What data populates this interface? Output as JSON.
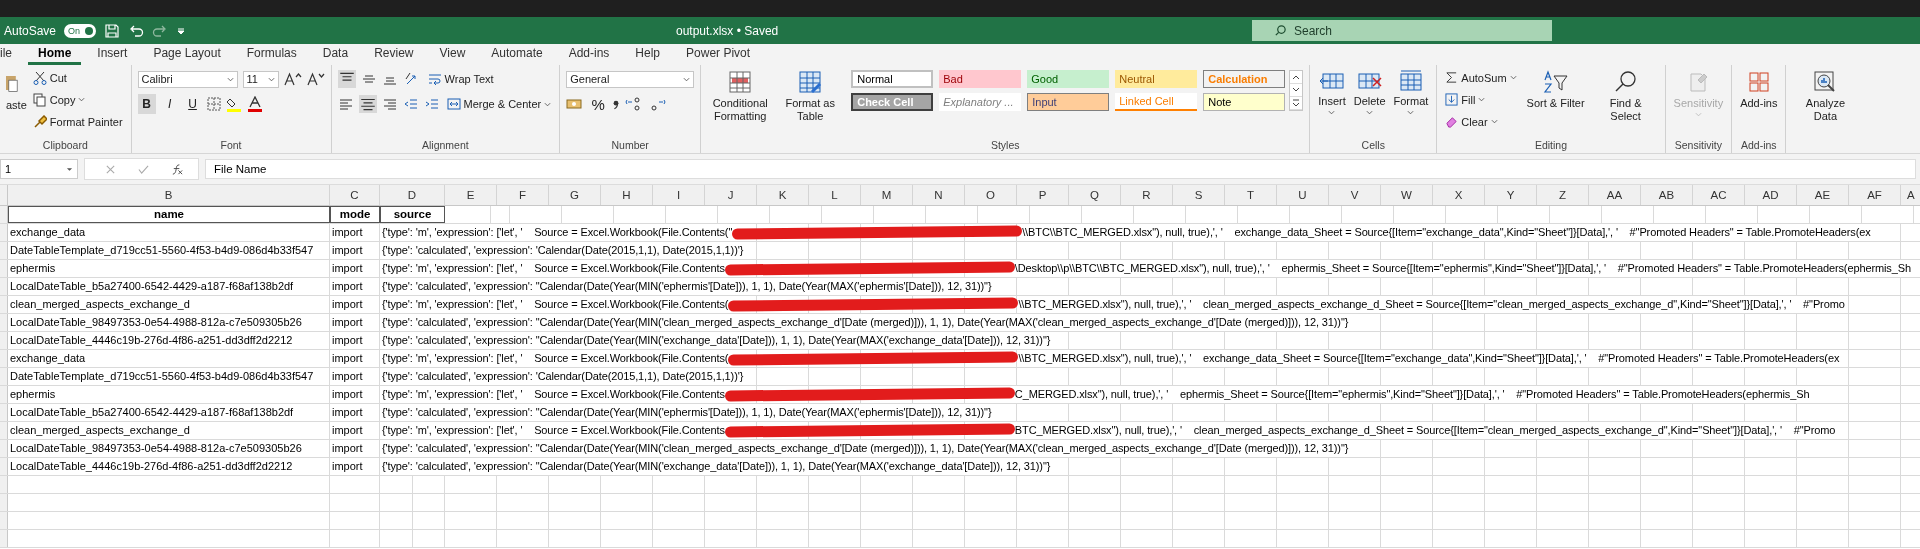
{
  "title_bar": {
    "autosave_label": "AutoSave",
    "autosave_toggle": {
      "label": "On",
      "on": true
    },
    "title": "output.xlsx • Saved",
    "search": {
      "placeholder": "Search"
    }
  },
  "tabs": [
    {
      "label": "ile",
      "selected": false
    },
    {
      "label": "Home",
      "selected": true
    },
    {
      "label": "Insert",
      "selected": false
    },
    {
      "label": "Page Layout",
      "selected": false
    },
    {
      "label": "Formulas",
      "selected": false
    },
    {
      "label": "Data",
      "selected": false
    },
    {
      "label": "Review",
      "selected": false
    },
    {
      "label": "View",
      "selected": false
    },
    {
      "label": "Automate",
      "selected": false
    },
    {
      "label": "Add-ins",
      "selected": false
    },
    {
      "label": "Help",
      "selected": false
    },
    {
      "label": "Power Pivot",
      "selected": false
    }
  ],
  "ribbon": {
    "clipboard": {
      "paste": "aste",
      "cut": "Cut",
      "copy": "Copy",
      "format_painter": "Format Painter",
      "label": "Clipboard"
    },
    "font": {
      "name": "Calibri",
      "size": "11",
      "bold": "B",
      "italic": "I",
      "underline": "U",
      "label": "Font"
    },
    "alignment": {
      "wrap_text": "Wrap Text",
      "merge": "Merge & Center",
      "label": "Alignment"
    },
    "number": {
      "format": "General",
      "percent": "%",
      "label": "Number"
    },
    "styles": {
      "conditional": "Conditional Formatting",
      "format_table": "Format as Table",
      "label": "Styles",
      "cells": [
        {
          "label": "Normal",
          "color": "#ffffff"
        },
        {
          "label": "Bad",
          "color": "#ffc7ce"
        },
        {
          "label": "Good",
          "color": "#c6efce"
        },
        {
          "label": "Neutral",
          "color": "#ffeb9c"
        },
        {
          "label": "Calculation",
          "color": "#f2f2f2"
        },
        {
          "label": "Check Cell",
          "color": "#a5a5a5"
        },
        {
          "label": "Explanatory ...",
          "color": "#ffffff"
        },
        {
          "label": "Input",
          "color": "#ffcc99"
        },
        {
          "label": "Linked Cell",
          "color": "#ffffff"
        },
        {
          "label": "Note",
          "color": "#ffffcc"
        }
      ]
    },
    "cells": {
      "insert": "Insert",
      "delete": "Delete",
      "format": "Format",
      "label": "Cells"
    },
    "editing": {
      "autosum": "AutoSum",
      "fill": "Fill",
      "clear": "Clear",
      "sort": "Sort & Filter",
      "find": "Find & Select",
      "label": "Editing"
    },
    "sensitivity": {
      "button": "Sensitivity",
      "disabled": true,
      "label": "Sensitivity"
    },
    "addins": {
      "addins": "Add-ins",
      "analyze": "Analyze Data",
      "label": "Add-ins"
    }
  },
  "formula_bar": {
    "name_box": "1",
    "formula": "File Name"
  },
  "columns": [
    "B",
    "C",
    "D",
    "E",
    "F",
    "G",
    "H",
    "I",
    "J",
    "K",
    "L",
    "M",
    "N",
    "O",
    "P",
    "Q",
    "R",
    "S",
    "T",
    "U",
    "V",
    "W",
    "X",
    "Y",
    "Z",
    "AA",
    "AB",
    "AC",
    "AD",
    "AE",
    "AF",
    "A"
  ],
  "table": {
    "columns": [
      "name",
      "mode",
      "source"
    ],
    "rows": [
      {
        "name": "exchange_data",
        "mode": "import",
        "source": {
          "text": "{'type': 'm', 'expression': ['let', '    Source = Excel.Workbook(File.Contents(\"",
          "redacted": true,
          "after": "\\\\BTC\\\\BTC_MERGED.xlsx\"), null, true),', '    exchange_data_Sheet = Source{[Item=\"exchange_data\",Kind=\"Sheet\"]}[Data],', '    #\"Promoted Headers\" = Table.PromoteHeaders(ex"
        }
      },
      {
        "name": "DateTableTemplate_d719cc51-5560-4f53-b4d9-086d4b33f547",
        "mode": "import",
        "source": {
          "text": "{'type': 'calculated', 'expression': 'Calendar(Date(2015,1,1), Date(2015,1,1))'}",
          "redacted": false
        }
      },
      {
        "name": "ephermis",
        "mode": "import",
        "source": {
          "text": "{'type': 'm', 'expression': ['let', '    Source = Excel.Workbook(File.Contents",
          "redacted": true,
          "after": "\\Desktop\\\\p\\\\BTC\\\\BTC_MERGED.xlsx\"), null, true),', '    ephermis_Sheet = Source{[Item=\"ephermis\",Kind=\"Sheet\"]}[Data],', '    #\"Promoted Headers\" = Table.PromoteHeaders(ephermis_Sh"
        }
      },
      {
        "name": "LocalDateTable_b5a27400-6542-4429-a187-f68af138b2df",
        "mode": "import",
        "source": {
          "text": "{'type': 'calculated', 'expression': \"Calendar(Date(Year(MIN('ephermis'[Date])), 1, 1), Date(Year(MAX('ephermis'[Date])), 12, 31))\"}",
          "redacted": false
        }
      },
      {
        "name": "clean_merged_aspects_exchange_d",
        "mode": "import",
        "source": {
          "text": "{'type': 'm', 'expression': ['let', '    Source = Excel.Workbook(File.Contents(",
          "redacted": true,
          "after": "\\\\BTC_MERGED.xlsx\"), null, true),', '    clean_merged_aspects_exchange_d_Sheet = Source{[Item=\"clean_merged_aspects_exchange_d\",Kind=\"Sheet\"]}[Data],', '    #\"Promo"
        }
      },
      {
        "name": "LocalDateTable_98497353-0e54-4988-812a-c7e509305b26",
        "mode": "import",
        "source": {
          "text": "{'type': 'calculated', 'expression': \"Calendar(Date(Year(MIN('clean_merged_aspects_exchange_d'[Date (merged)])), 1, 1), Date(Year(MAX('clean_merged_aspects_exchange_d'[Date (merged)])), 12, 31))\"}",
          "redacted": false
        }
      },
      {
        "name": "LocalDateTable_4446c19b-276d-4f86-a251-dd3dff2d2212",
        "mode": "import",
        "source": {
          "text": "{'type': 'calculated', 'expression': \"Calendar(Date(Year(MIN('exchange_data'[Date])), 1, 1), Date(Year(MAX('exchange_data'[Date])), 12, 31))\"}",
          "redacted": false
        }
      },
      {
        "name": "exchange_data",
        "mode": "import",
        "source": {
          "text": "{'type': 'm', 'expression': ['let', '    Source = Excel.Workbook(File.Contents(",
          "redacted": true,
          "after": "\\\\BTC_MERGED.xlsx\"), null, true),', '    exchange_data_Sheet = Source{[Item=\"exchange_data\",Kind=\"Sheet\"]}[Data],', '    #\"Promoted Headers\" = Table.PromoteHeaders(ex"
        }
      },
      {
        "name": "DateTableTemplate_d719cc51-5560-4f53-b4d9-086d4b33f547",
        "mode": "import",
        "source": {
          "text": "{'type': 'calculated', 'expression': 'Calendar(Date(2015,1,1), Date(2015,1,1))'}",
          "redacted": false
        }
      },
      {
        "name": "ephermis",
        "mode": "import",
        "source": {
          "text": "{'type': 'm', 'expression': ['let', '    Source = Excel.Workbook(File.Contents",
          "redacted": true,
          "after": "C_MERGED.xlsx\"), null, true),', '    ephermis_Sheet = Source{[Item=\"ephermis\",Kind=\"Sheet\"]}[Data],', '    #\"Promoted Headers\" = Table.PromoteHeaders(ephermis_Sh"
        }
      },
      {
        "name": "LocalDateTable_b5a27400-6542-4429-a187-f68af138b2df",
        "mode": "import",
        "source": {
          "text": "{'type': 'calculated', 'expression': \"Calendar(Date(Year(MIN('ephermis'[Date])), 1, 1), Date(Year(MAX('ephermis'[Date])), 12, 31))\"}",
          "redacted": false
        }
      },
      {
        "name": "clean_merged_aspects_exchange_d",
        "mode": "import",
        "source": {
          "text": "{'type': 'm', 'expression': ['let', '    Source = Excel.Workbook(File.Contents",
          "redacted": true,
          "after": "BTC_MERGED.xlsx\"), null, true),', '    clean_merged_aspects_exchange_d_Sheet = Source{[Item=\"clean_merged_aspects_exchange_d\",Kind=\"Sheet\"]}[Data],', '    #\"Promo"
        }
      },
      {
        "name": "LocalDateTable_98497353-0e54-4988-812a-c7e509305b26",
        "mode": "import",
        "source": {
          "text": "{'type': 'calculated', 'expression': \"Calendar(Date(Year(MIN('clean_merged_aspects_exchange_d'[Date (merged)])), 1, 1), Date(Year(MAX('clean_merged_aspects_exchange_d'[Date (merged)])), 12, 31))\"}",
          "redacted": false
        }
      },
      {
        "name": "LocalDateTable_4446c19b-276d-4f86-a251-dd3dff2d2212",
        "mode": "import",
        "source": {
          "text": "{'type': 'calculated', 'expression': \"Calendar(Date(Year(MIN('exchange_data'[Date])), 1, 1), Date(Year(MAX('exchange_data'[Date])), 12, 31))\"}",
          "redacted": false
        }
      }
    ]
  }
}
